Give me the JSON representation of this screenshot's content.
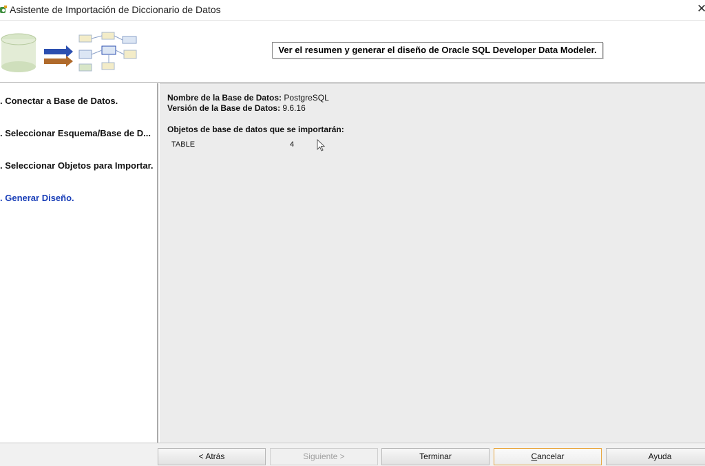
{
  "window": {
    "title": "Asistente de Importación de Diccionario de Datos",
    "close_glyph": "✕"
  },
  "banner": {
    "headline": "Ver el resumen y generar el diseño de Oracle SQL Developer Data Modeler."
  },
  "steps": [
    {
      "label": ". Conectar a Base de Datos.",
      "active": false
    },
    {
      "label": ". Seleccionar Esquema/Base de D...",
      "active": false
    },
    {
      "label": ". Seleccionar Objetos para Importar.",
      "active": false
    },
    {
      "label": ". Generar Diseño.",
      "active": true
    }
  ],
  "summary": {
    "db_name_label": "Nombre de la Base de Datos:",
    "db_name_value": "PostgreSQL",
    "db_version_label": "Versión de la Base de Datos:",
    "db_version_value": "9.6.16",
    "objects_heading": "Objetos de base de datos que se importarán:",
    "objects": [
      {
        "type": "TABLE",
        "count": "4"
      }
    ]
  },
  "buttons": {
    "back": "< Atrás",
    "next": "Siguiente >",
    "finish": "Terminar",
    "cancel_first": "C",
    "cancel_rest": "ancelar",
    "help": "Ayuda"
  },
  "icons": {
    "app": "data-modeler-app-icon",
    "banner": "import-wizard-graphic",
    "cursor": "mouse-pointer-icon"
  }
}
